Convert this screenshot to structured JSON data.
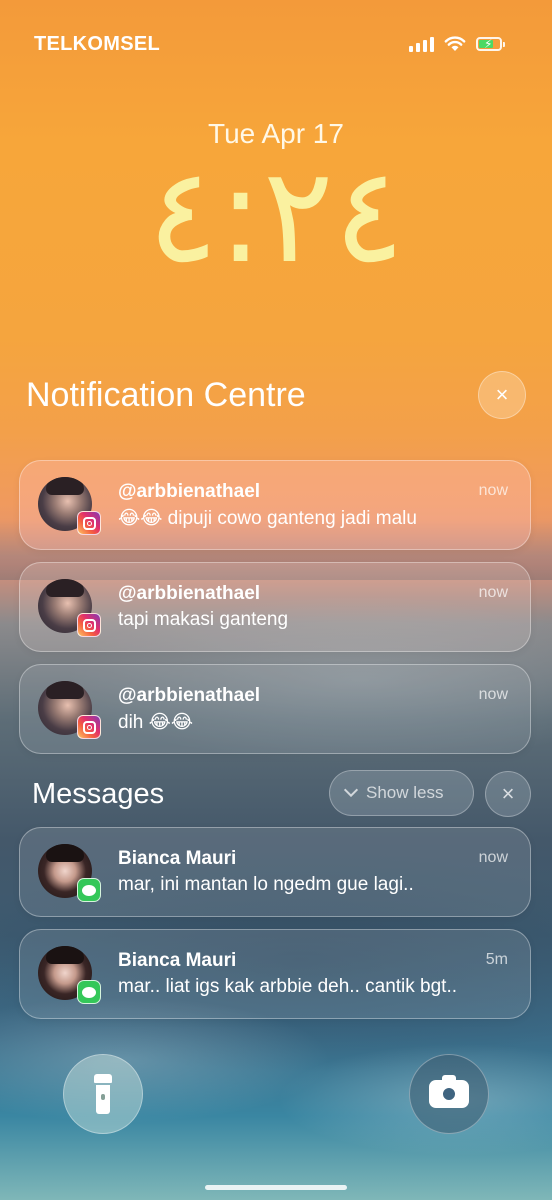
{
  "status_bar": {
    "carrier": "TELKOMSEL",
    "signal_bars": 4,
    "battery_level": 0.7,
    "battery_charging": true,
    "battery_color": "#4cd964"
  },
  "lock_screen": {
    "date": "Tue Apr 17",
    "time": "٤:٢٤"
  },
  "notification_centre": {
    "title": "Notification Centre",
    "close_icon": "×"
  },
  "instagram_notifications": [
    {
      "sender": "@arbbienathael",
      "message": "😂😂 dipuji cowo ganteng jadi malu",
      "time": "now",
      "app": "instagram-icon"
    },
    {
      "sender": "@arbbienathael",
      "message": "tapi makasi ganteng",
      "time": "now",
      "app": "instagram-icon"
    },
    {
      "sender": "@arbbienathael",
      "message": "dih 😂😂",
      "time": "now",
      "app": "instagram-icon"
    }
  ],
  "messages_group": {
    "title": "Messages",
    "show_less": "Show less",
    "close_icon": "×",
    "items": [
      {
        "sender": "Bianca Mauri",
        "message": "mar, ini mantan lo ngedm gue lagi..",
        "time": "now",
        "app": "messages-icon"
      },
      {
        "sender": "Bianca Mauri",
        "message": "mar.. liat igs kak arbbie deh.. cantik bgt..",
        "time": "5m",
        "app": "messages-icon"
      }
    ]
  },
  "quick_actions": {
    "flashlight_icon": "flashlight-icon",
    "camera_icon": "camera-icon"
  }
}
